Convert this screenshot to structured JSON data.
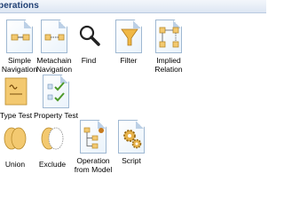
{
  "panel": {
    "title": "perations"
  },
  "items": [
    {
      "label": "Simple",
      "label2": "Navigation"
    },
    {
      "label": "Metachain",
      "label2": "Navigation"
    },
    {
      "label": "Find"
    },
    {
      "label": "Filter"
    },
    {
      "label": "Implied",
      "label2": "Relation"
    },
    {
      "label": "Type Test"
    },
    {
      "label": "Property Test"
    },
    {
      "label": "Union"
    },
    {
      "label": "Exclude"
    },
    {
      "label": "Operation",
      "label2": "from Model"
    },
    {
      "label": "Script"
    }
  ],
  "colors": {
    "header_text": "#1f3f73",
    "box_fill": "#f3c970",
    "check": "#4d9a2a",
    "funnel": "#f0b845"
  }
}
